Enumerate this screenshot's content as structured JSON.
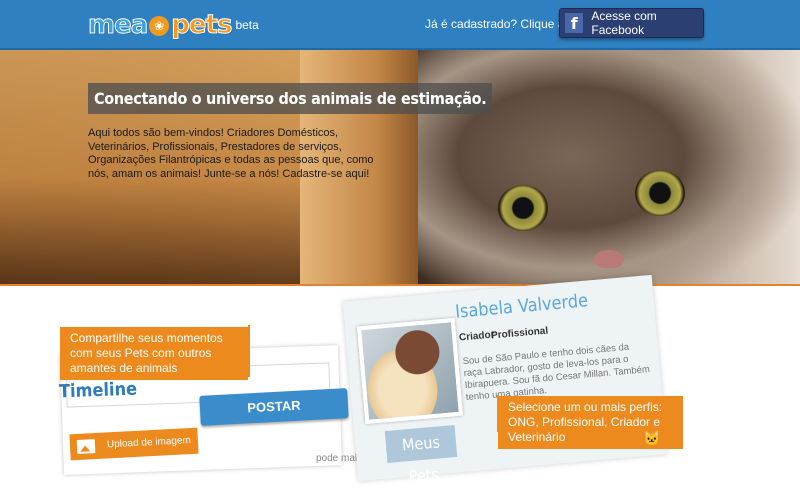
{
  "header": {
    "logo_word_1": "mea",
    "logo_word_2": "pets",
    "logo_badge": "beta",
    "already_registered": "Já é cadastrado? Clique aqui",
    "facebook_button": "Acesse com Facebook",
    "facebook_icon_glyph": "f"
  },
  "hero": {
    "tagline": "Conectando o universo dos animais de estimação.",
    "intro": "Aqui todos são bem-vindos! Criadores Domésticos, Veterinários, Profissionais, Prestadores de serviços, Organizações Filantrópicas e todas as pessoas que, como nós, amam os animais! Junte-se a nós! Cadastre-se aqui!"
  },
  "features": {
    "share_note": "Compartilhe seus momentos com seus Pets com outros amantes de animais",
    "timeline_title": "Timeline",
    "post_button": "POSTAR",
    "upload_button": "Upload de imagem",
    "cut_text": "pode mal a",
    "profile": {
      "name": "Isabela Valverde",
      "tag_1": "Criador",
      "tag_2": "Profissional",
      "bio": "Sou de São Paulo e tenho dois cães da raça Labrador, gosto de leva-los para o Ibirapuera. Sou fã do Cesar Millan. Também tenho uma gatinha."
    },
    "profiles_note": "Selecione um ou mais perfis: ONG, Profissional, Criador e Veterinário",
    "my_pets": "Meus Pets"
  },
  "colors": {
    "header_blue": "#2f80c0",
    "accent_orange": "#ec8a1e",
    "facebook_navy": "#2b3f72",
    "timeline_blue": "#2e7bb7"
  },
  "icons": {
    "logo_paw": "paw-icon",
    "facebook": "facebook-icon",
    "upload": "image-icon",
    "pet": "cat-icon"
  }
}
